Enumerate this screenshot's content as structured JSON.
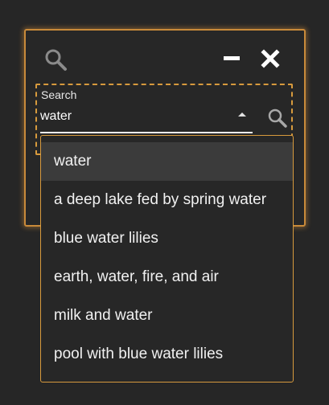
{
  "window": {
    "icons": {
      "search": "search-icon",
      "minimize": "minimize-icon",
      "close": "close-icon"
    }
  },
  "search": {
    "label": "Search",
    "value": "water",
    "placeholder": ""
  },
  "dropdown": {
    "options": [
      "water",
      "a deep lake fed by spring water",
      "blue water lilies",
      "earth, water, fire, and air",
      "milk and water",
      "pool with blue water lilies"
    ],
    "selected_index": 0
  },
  "colors": {
    "accent": "#d79a3d",
    "background": "#262626",
    "highlight": "#3b3b3b",
    "text": "#f1f1f1"
  }
}
